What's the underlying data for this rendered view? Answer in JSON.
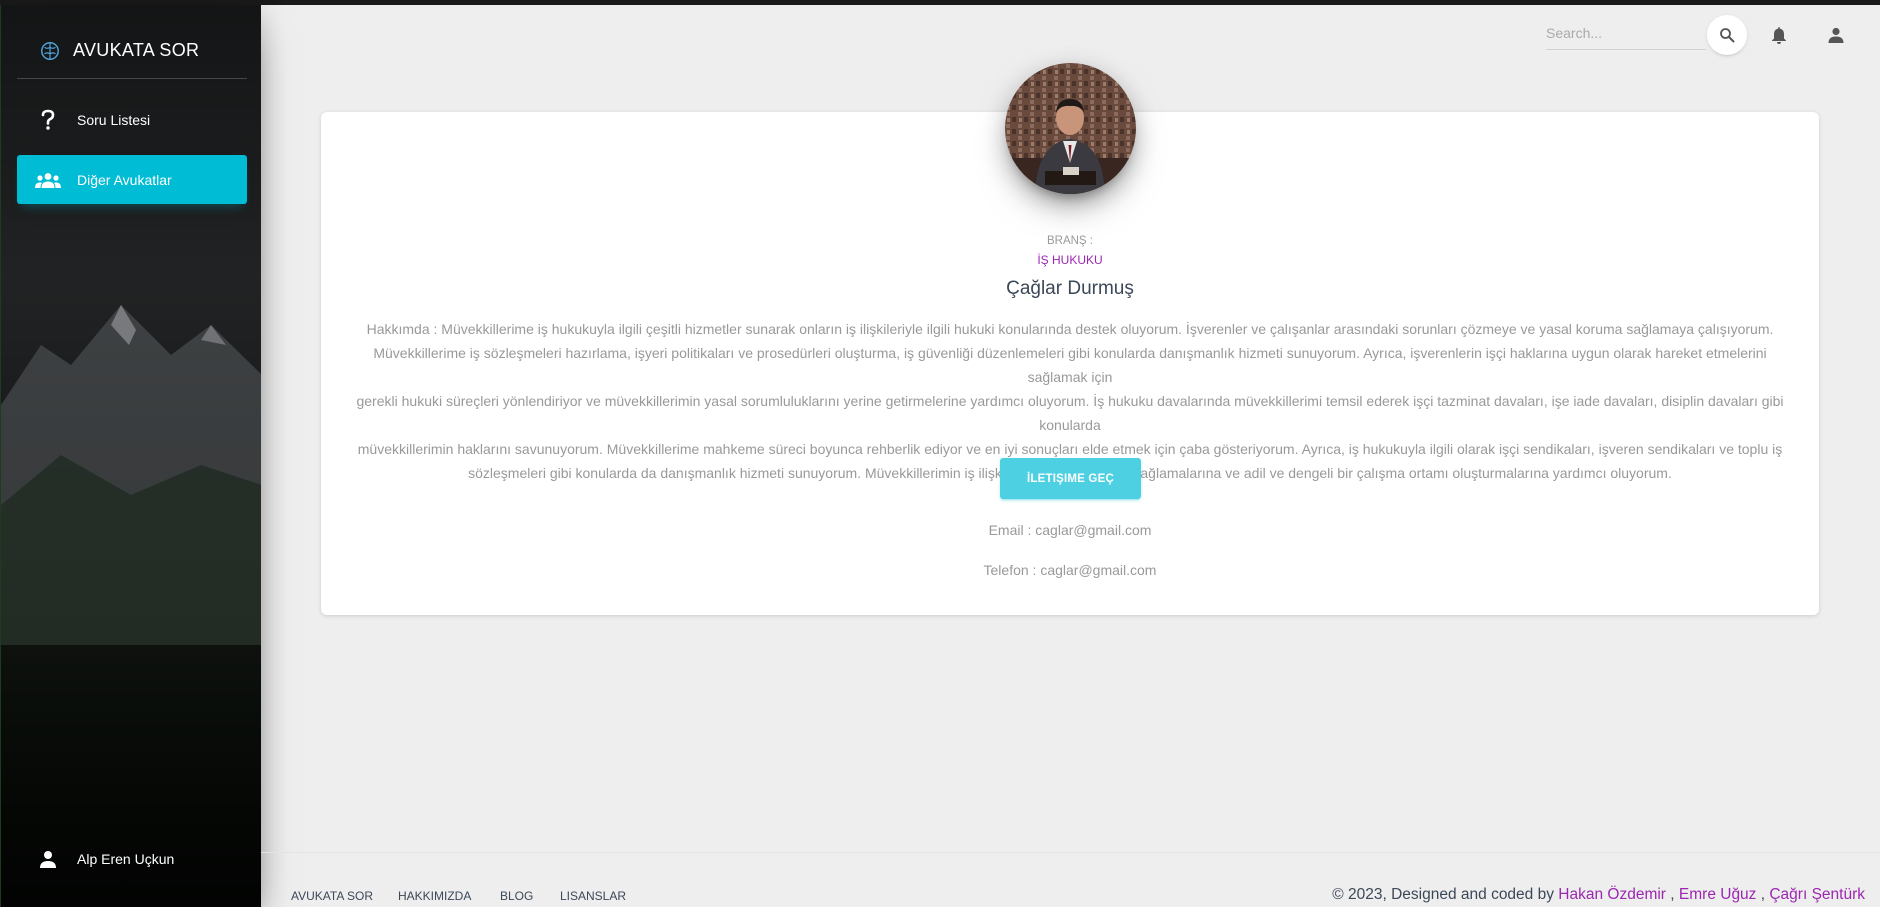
{
  "brand": {
    "name": "AVUKATA SOR"
  },
  "sidebar": {
    "items": [
      {
        "label": "Soru Listesi",
        "icon": "question-icon",
        "active": false
      },
      {
        "label": "Diğer Avukatlar",
        "icon": "group-icon",
        "active": true
      }
    ],
    "user": {
      "name": "Alp Eren Uçkun",
      "icon": "person-icon"
    }
  },
  "navbar": {
    "search_placeholder": "Search...",
    "icons": [
      "search-icon",
      "bell-icon",
      "person-icon"
    ]
  },
  "profile": {
    "branch_label": "BRANŞ :",
    "branch_value": "İŞ HUKUKU",
    "name": "Çağlar Durmuş",
    "about_lines": [
      "Hakkımda : Müvekkillerime iş hukukuyla ilgili çeşitli hizmetler sunarak onların iş ilişkileriyle ilgili hukuki konularında destek oluyorum. İşverenler ve çalışanlar arasındaki sorunları çözmeye ve yasal koruma sağlamaya çalışıyorum.",
      "Müvekkillerime iş sözleşmeleri hazırlama, işyeri politikaları ve prosedürleri oluşturma, iş güvenliği düzenlemeleri gibi konularda danışmanlık hizmeti sunuyorum. Ayrıca, işverenlerin işçi haklarına uygun olarak hareket etmelerini sağlamak için",
      "gerekli hukuki süreçleri yönlendiriyor ve müvekkillerimin yasal sorumluluklarını yerine getirmelerine yardımcı oluyorum. İş hukuku davalarında müvekkillerimi temsil ederek işçi tazminat davaları, işe iade davaları, disiplin davaları gibi konularda",
      "müvekkillerimin haklarını savunuyorum. Müvekkillerime mahkeme süreci boyunca rehberlik ediyor ve en iyi sonuçları elde etmek için çaba gösteriyorum. Ayrıca, iş hukukuyla ilgili olarak işçi sendikaları, işveren sendikaları ve toplu iş",
      "sözleşmeleri gibi konularda da danışmanlık hizmeti sunuyorum. Müvekkillerimin iş ilişkilerinde yasal uyumu sağlamalarına ve adil ve dengeli bir çalışma ortamı oluşturmalarına yardımcı oluyorum."
    ],
    "contact_button": "İLETIŞIME GEÇ",
    "email": "Email : caglar@gmail.com",
    "phone": "Telefon : caglar@gmail.com"
  },
  "footer": {
    "links": [
      "AVUKATA SOR",
      "HAKKIMIZDA",
      "BLOG",
      "LISANSLAR"
    ],
    "copyright_prefix": "© 2023, Designed and coded by",
    "authors": [
      "Hakan Özdemir",
      "Emre Uğuz",
      "Çağrı Şentürk"
    ],
    "separator": " , "
  },
  "colors": {
    "accent": "#00bcd4",
    "button": "#4dd0e1",
    "purple": "#9c27b0",
    "background": "#eeeeee"
  }
}
